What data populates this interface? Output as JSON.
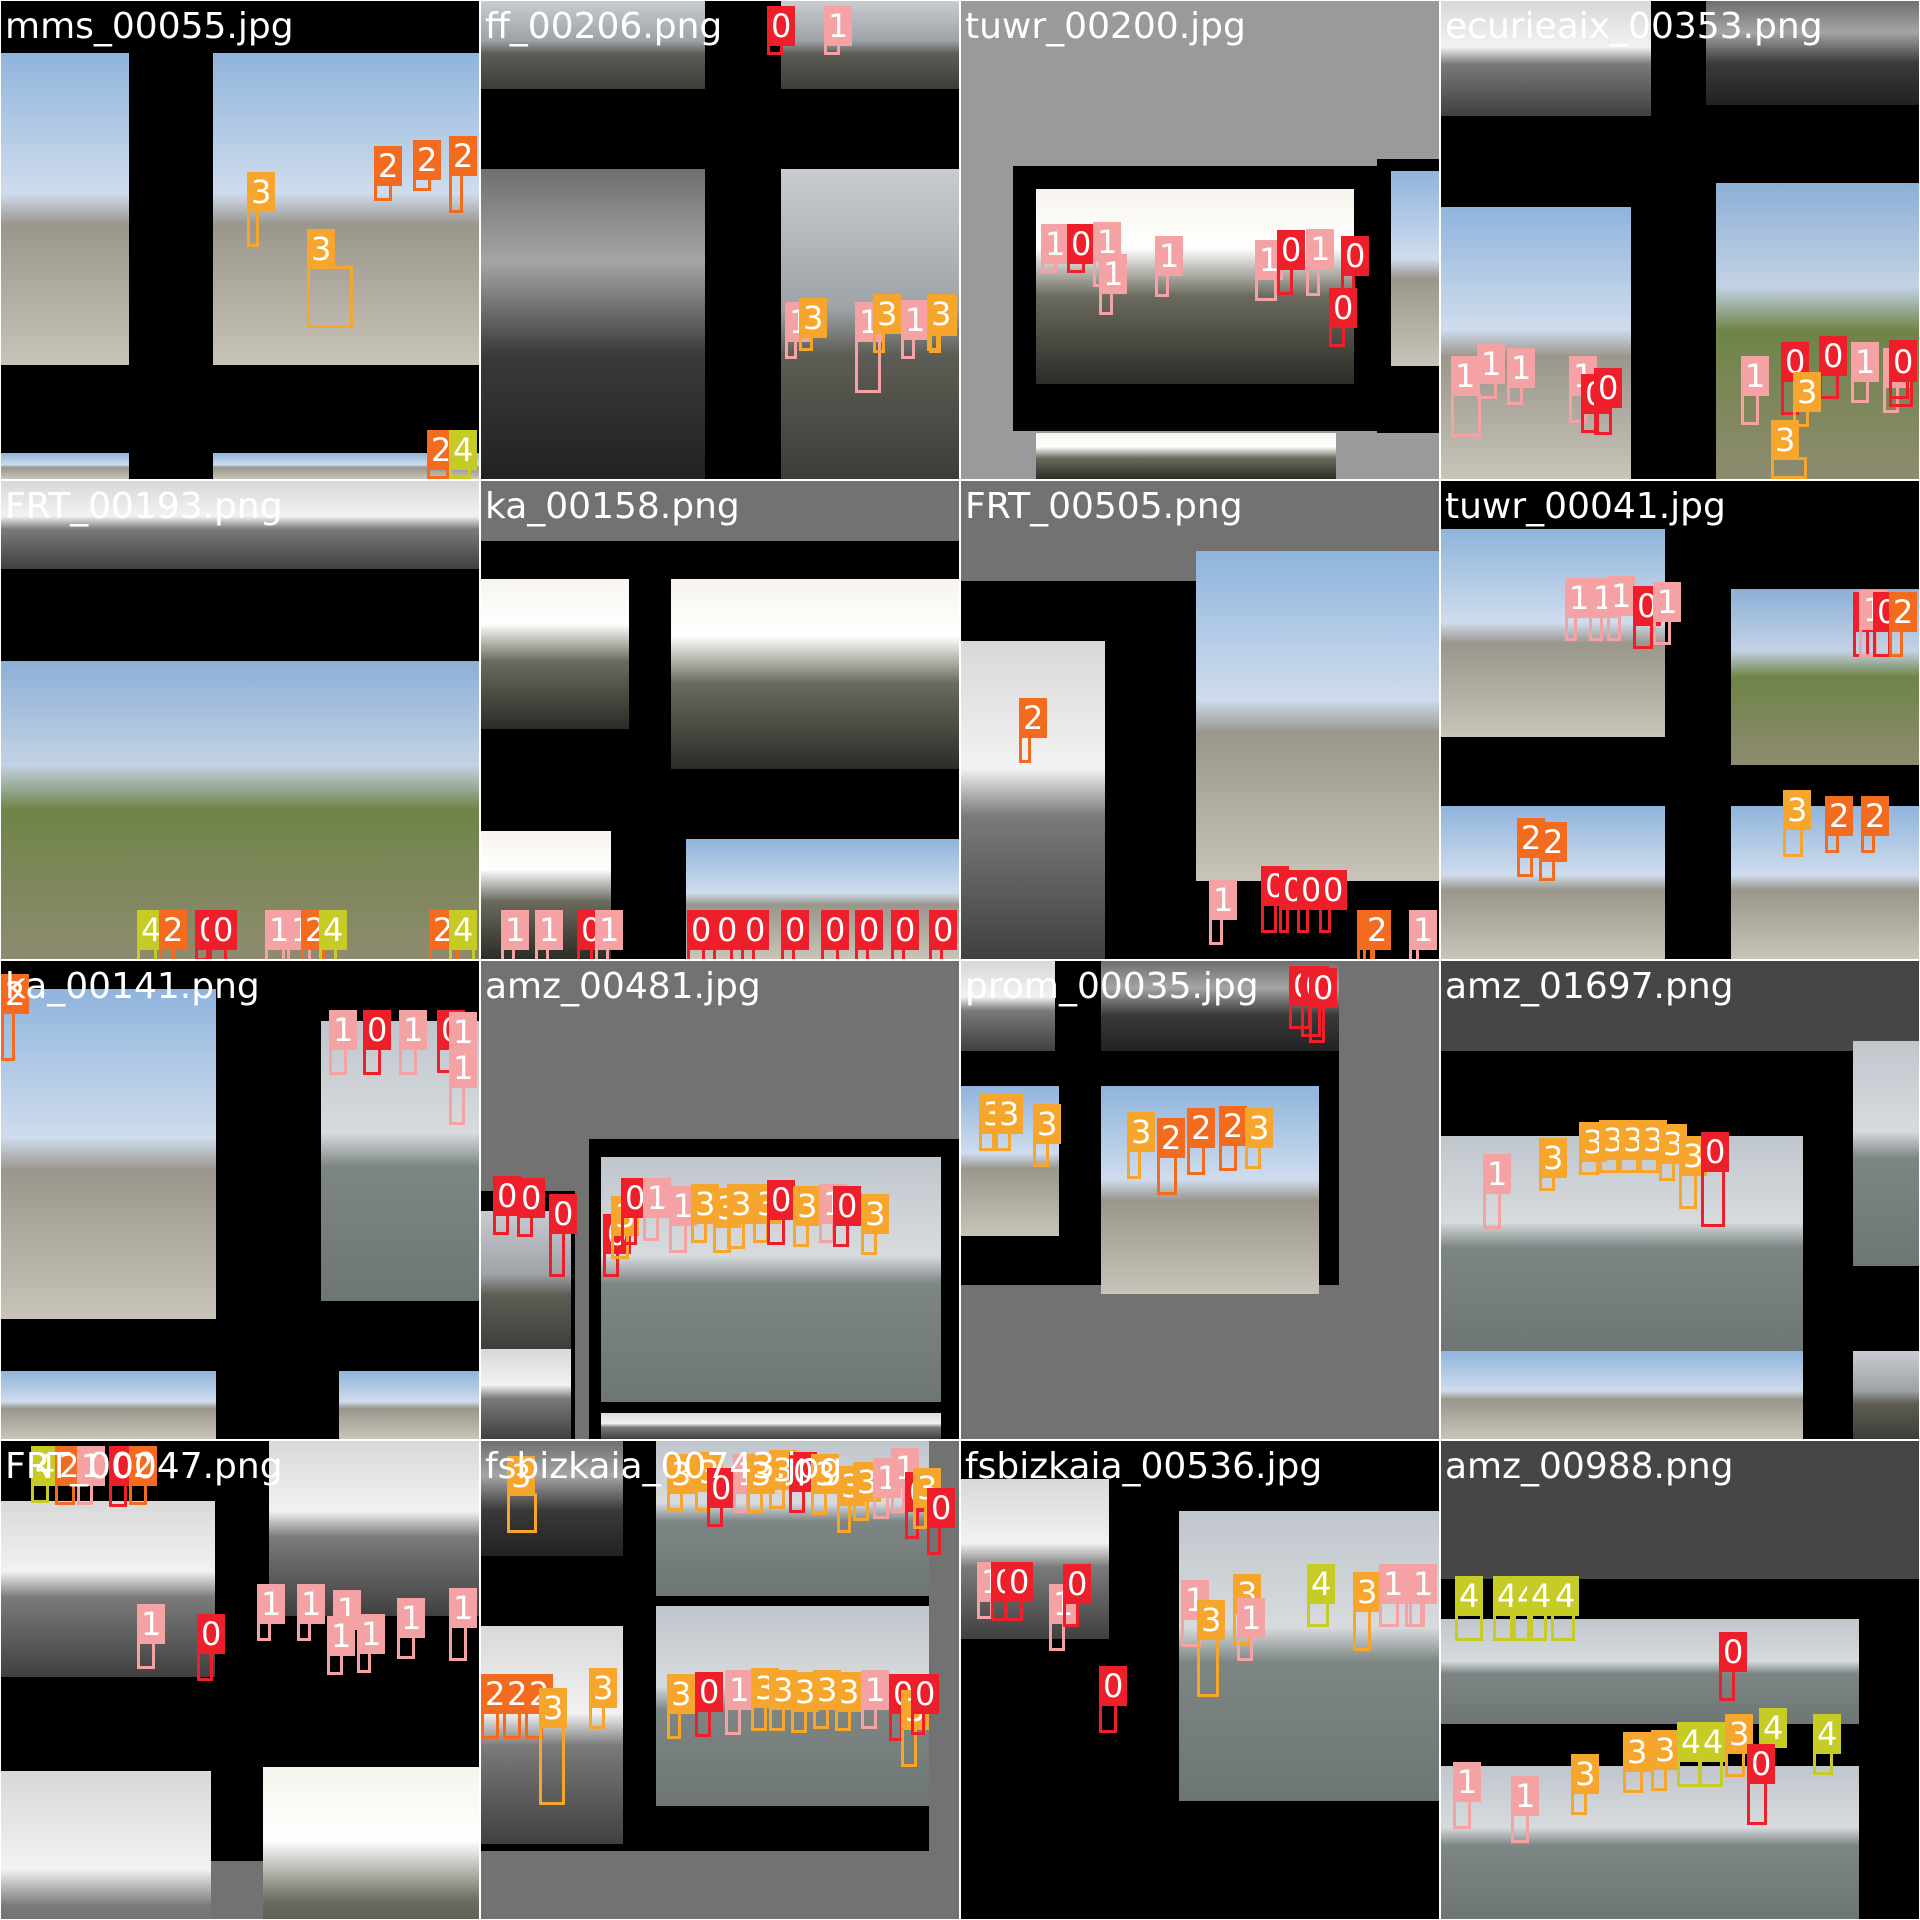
{
  "class_colors": {
    "0": "#ee1f2b",
    "1": "#f4a2a4",
    "2": "#f26b1f",
    "3": "#f6a62d",
    "4": "#c6cc25"
  },
  "tiles": [
    {
      "filename": "mms_00055.jpg",
      "labels": [
        "3",
        "3",
        "2",
        "2",
        "2",
        "2",
        "4"
      ]
    },
    {
      "filename": "ff_00206.png",
      "labels": [
        "0",
        "1",
        "1",
        "3",
        "1",
        "3",
        "1",
        "3",
        "3"
      ]
    },
    {
      "filename": "tuwr_00200.jpg",
      "labels": [
        "1",
        "0",
        "1",
        "1",
        "1",
        "1",
        "0",
        "1",
        "0",
        "0"
      ]
    },
    {
      "filename": "ecurieaix_00353.png",
      "labels": [
        "1",
        "1",
        "1",
        "1",
        "0",
        "0",
        "1",
        "0",
        "0",
        "1",
        "1",
        "0",
        "0",
        "3",
        "3"
      ]
    },
    {
      "filename": "FRT_00193.png",
      "labels": [
        "4",
        "2",
        "0",
        "0",
        "1",
        "1",
        "2",
        "4",
        "2",
        "4"
      ]
    },
    {
      "filename": "ka_00158.png",
      "labels": [
        "0",
        "0",
        "0",
        "1",
        "0",
        "0",
        "0",
        "0",
        "0",
        "0",
        "0",
        "0",
        "1",
        "0",
        "1",
        "0",
        "1",
        "1"
      ]
    },
    {
      "filename": "FRT_00505.png",
      "labels": [
        "2",
        "2",
        "1",
        "2",
        "1",
        "0",
        "0",
        "0",
        "0"
      ]
    },
    {
      "filename": "tuwr_00041.jpg",
      "labels": [
        "1",
        "1",
        "1",
        "0",
        "1",
        "0",
        "1",
        "0",
        "2",
        "2",
        "2",
        "3",
        "2",
        "2"
      ]
    },
    {
      "filename": "ka_00141.png",
      "labels": [
        "2",
        "1",
        "0",
        "1",
        "0",
        "1",
        "1"
      ]
    },
    {
      "filename": "amz_00481.jpg",
      "labels": [
        "0",
        "0",
        "0",
        "0",
        "3",
        "0",
        "1",
        "1",
        "3",
        "3",
        "3",
        "3",
        "0",
        "3",
        "1",
        "0",
        "3"
      ]
    },
    {
      "filename": "prom_00035.jpg",
      "labels": [
        "3",
        "3",
        "3",
        "3",
        "2",
        "2",
        "2",
        "3",
        "0",
        "0",
        "0"
      ]
    },
    {
      "filename": "amz_01697.png",
      "labels": [
        "1",
        "3",
        "3",
        "3",
        "3",
        "3",
        "3",
        "3",
        "0"
      ]
    },
    {
      "filename": "FRT_00047.png",
      "labels": [
        "4",
        "2",
        "1",
        "0",
        "2",
        "1",
        "1",
        "1",
        "1",
        "1",
        "1",
        "1",
        "0",
        "1"
      ]
    },
    {
      "filename": "fsbizkaia_00743.jpg",
      "labels": [
        "3",
        "3",
        "3",
        "0",
        "1",
        "3",
        "3",
        "0",
        "3",
        "3",
        "3",
        "1",
        "1",
        "0",
        "3",
        "0",
        "2",
        "2",
        "2",
        "3",
        "3",
        "3",
        "0",
        "1",
        "3",
        "3",
        "3",
        "3",
        "3",
        "1",
        "0",
        "3",
        "0"
      ]
    },
    {
      "filename": "fsbizkaia_00536.jpg",
      "labels": [
        "1",
        "0",
        "0",
        "1",
        "0",
        "0",
        "1",
        "3",
        "3",
        "1",
        "4",
        "3",
        "1",
        "1",
        "1",
        "1"
      ]
    },
    {
      "filename": "amz_00988.png",
      "labels": [
        "4",
        "4",
        "4",
        "4",
        "4",
        "0",
        "1",
        "1",
        "3",
        "3",
        "3",
        "4",
        "4",
        "3",
        "4",
        "4",
        "0"
      ]
    }
  ]
}
